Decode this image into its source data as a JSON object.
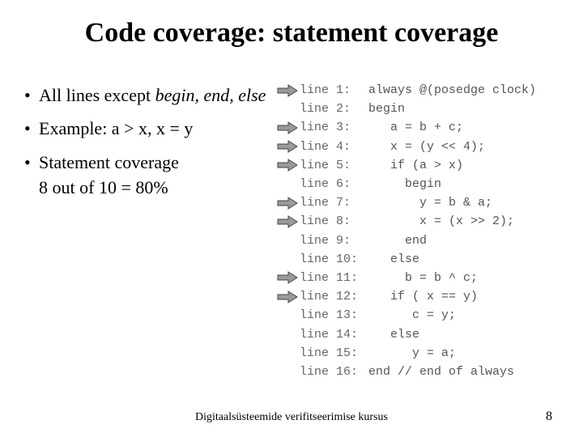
{
  "title": "Code coverage: statement coverage",
  "bullets": [
    {
      "pre": "All lines except ",
      "em": "begin, end, else"
    },
    {
      "pre": "Example: a > x, x = y",
      "em": ""
    },
    {
      "pre": "Statement coverage",
      "em": ""
    }
  ],
  "indent_line": "8 out of 10 = 80%",
  "code": {
    "lines": [
      {
        "n": 1,
        "arrow": true,
        "ln": "line 1:",
        "txt": " always @(posedge clock)"
      },
      {
        "n": 2,
        "arrow": false,
        "ln": "line 2:",
        "txt": " begin"
      },
      {
        "n": 3,
        "arrow": true,
        "ln": "line 3:",
        "txt": "    a = b + c;"
      },
      {
        "n": 4,
        "arrow": true,
        "ln": "line 4:",
        "txt": "    x = (y << 4);"
      },
      {
        "n": 5,
        "arrow": true,
        "ln": "line 5:",
        "txt": "    if (a > x)"
      },
      {
        "n": 6,
        "arrow": false,
        "ln": "line 6:",
        "txt": "      begin"
      },
      {
        "n": 7,
        "arrow": true,
        "ln": "line 7:",
        "txt": "        y = b & a;"
      },
      {
        "n": 8,
        "arrow": true,
        "ln": "line 8:",
        "txt": "        x = (x >> 2);"
      },
      {
        "n": 9,
        "arrow": false,
        "ln": "line 9:",
        "txt": "      end"
      },
      {
        "n": 10,
        "arrow": false,
        "ln": "line 10:",
        "txt": "    else"
      },
      {
        "n": 11,
        "arrow": true,
        "ln": "line 11:",
        "txt": "      b = b ^ c;"
      },
      {
        "n": 12,
        "arrow": true,
        "ln": "line 12:",
        "txt": "    if ( x == y)"
      },
      {
        "n": 13,
        "arrow": false,
        "ln": "line 13:",
        "txt": "       c = y;"
      },
      {
        "n": 14,
        "arrow": false,
        "ln": "line 14:",
        "txt": "    else"
      },
      {
        "n": 15,
        "arrow": false,
        "ln": "line 15:",
        "txt": "       y = a;"
      },
      {
        "n": 16,
        "arrow": false,
        "ln": "line 16:",
        "txt": " end // end of always"
      }
    ]
  },
  "footer": {
    "center": "Digitaalsüsteemide verifitseerimise kursus",
    "page": "8"
  },
  "colors": {
    "arrow_fill": "#9a9a9a",
    "arrow_stroke": "#444"
  }
}
